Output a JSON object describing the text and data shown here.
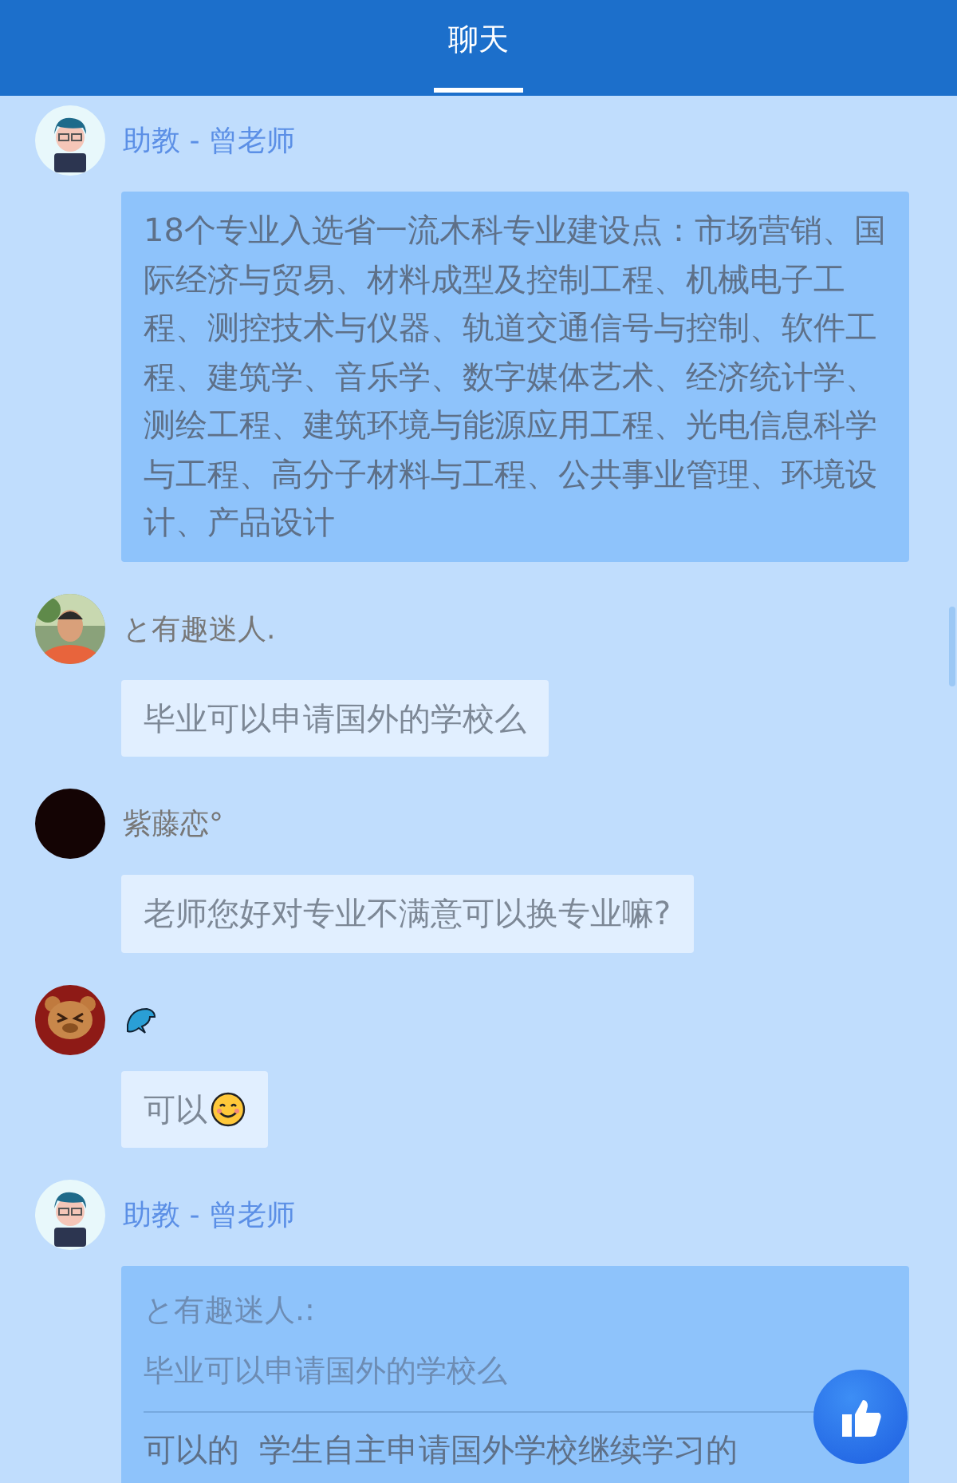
{
  "header": {
    "tabs": [
      {
        "label": "聊天",
        "selected": true
      }
    ]
  },
  "messages": [
    {
      "avatar": {
        "kind": "teacher"
      },
      "sender": {
        "kind": "staff",
        "name": "助教 - 曾老师"
      },
      "kind": "text",
      "text": "18个专业入选省一流木科专业建设点：市场营销、国际经济与贸易、材料成型及控制工程、机械电子工程、测控技术与仪器、轨道交通信号与控制、软件工程、建筑学、音乐学、数字媒体艺术、经济统计学、测绘工程、建筑环境与能源应用工程、光电信息科学与工程、高分子材料与工程、公共事业管理、环境设计、产品设计"
    },
    {
      "sender": {
        "kind": "user",
        "name": "と有趣迷人."
      },
      "kind": "text",
      "text": "毕业可以申请国外的学校么"
    },
    {
      "avatar": {
        "kind": "dark"
      },
      "sender": {
        "kind": "user",
        "name": "紫藤恋°"
      },
      "kind": "text",
      "text": "老师您好对专业不满意可以换专业嘛?"
    },
    {
      "avatar": {
        "kind": "bear"
      },
      "sender": {
        "kind": "emoji"
      },
      "kind": "text",
      "text": "可以",
      "smiley": true
    },
    {
      "avatar": {
        "kind": "teacher"
      },
      "sender": {
        "kind": "staff",
        "name": "助教 - 曾老师"
      },
      "kind": "reply",
      "quote_author": "と有趣迷人.:",
      "quote_text": "毕业可以申请国外的学校么",
      "text": "可以的  学生自主申请国外学校继续学习的"
    }
  ]
}
